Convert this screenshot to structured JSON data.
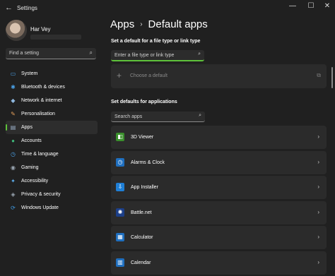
{
  "window": {
    "title": "Settings",
    "back_glyph": "←",
    "min_glyph": "—",
    "max_glyph": "☐",
    "close_glyph": "✕"
  },
  "profile": {
    "name": "Har Vey"
  },
  "sidebar_search": {
    "placeholder": "Find a setting",
    "icon": "⌕"
  },
  "nav": [
    {
      "label": "System",
      "icon": "▭",
      "color": "#4aa0e6"
    },
    {
      "label": "Bluetooth & devices",
      "icon": "✱",
      "color": "#4aa0e6"
    },
    {
      "label": "Network & internet",
      "icon": "◆",
      "color": "#8fb8e0"
    },
    {
      "label": "Personalisation",
      "icon": "✎",
      "color": "#e8a25c"
    },
    {
      "label": "Apps",
      "icon": "▤",
      "color": "#9ab0c8",
      "selected": true
    },
    {
      "label": "Accounts",
      "icon": "●",
      "color": "#3fb87a"
    },
    {
      "label": "Time & language",
      "icon": "◷",
      "color": "#4aa0e6"
    },
    {
      "label": "Gaming",
      "icon": "◉",
      "color": "#9aa6b2"
    },
    {
      "label": "Accessibility",
      "icon": "✦",
      "color": "#5fb0ef"
    },
    {
      "label": "Privacy & security",
      "icon": "◈",
      "color": "#9aa6b2"
    },
    {
      "label": "Windows Update",
      "icon": "⟳",
      "color": "#3f9ee8"
    }
  ],
  "breadcrumb": {
    "parent": "Apps",
    "separator": "›",
    "current": "Default apps"
  },
  "filetype": {
    "heading": "Set a default for a file type or link type",
    "placeholder": "Enter a file type or link type",
    "icon": "⌕",
    "choose_label": "Choose a default",
    "plus": "+",
    "ext": "⧉"
  },
  "applications": {
    "heading": "Set defaults for applications",
    "search_placeholder": "Search apps",
    "search_icon": "⌕",
    "chevron": "›",
    "items": [
      {
        "label": "3D Viewer",
        "icon": "◧",
        "bg": "#3a8f2c"
      },
      {
        "label": "Alarms & Clock",
        "icon": "◷",
        "bg": "#1f6fbf"
      },
      {
        "label": "App Installer",
        "icon": "⇩",
        "bg": "#1f7fd6"
      },
      {
        "label": "Battle.net",
        "icon": "✺",
        "bg": "#1c3f88"
      },
      {
        "label": "Calculator",
        "icon": "▦",
        "bg": "#1f6fbf"
      },
      {
        "label": "Calendar",
        "icon": "▥",
        "bg": "#1f6fbf"
      }
    ]
  }
}
